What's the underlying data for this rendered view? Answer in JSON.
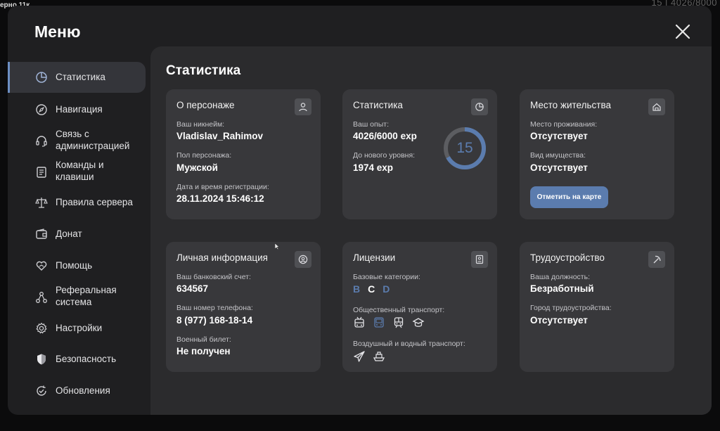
{
  "background": {
    "hud_left": "ерно 11к",
    "hud_right": "15 | 4026/8000"
  },
  "menu": {
    "title": "Меню"
  },
  "sidebar": {
    "items": [
      {
        "label": "Статистика",
        "icon": "pie-chart-icon"
      },
      {
        "label": "Навигация",
        "icon": "compass-icon"
      },
      {
        "label": "Связь с администрацией",
        "icon": "headset-icon"
      },
      {
        "label": "Команды и клавиши",
        "icon": "keyboard-icon"
      },
      {
        "label": "Правила сервера",
        "icon": "scales-icon"
      },
      {
        "label": "Донат",
        "icon": "wallet-icon"
      },
      {
        "label": "Помощь",
        "icon": "heart-hands-icon"
      },
      {
        "label": "Реферальная система",
        "icon": "network-icon"
      },
      {
        "label": "Настройки",
        "icon": "gear-icon"
      },
      {
        "label": "Безопасность",
        "icon": "shield-icon"
      },
      {
        "label": "Обновления",
        "icon": "refresh-check-icon"
      }
    ]
  },
  "main": {
    "title": "Статистика",
    "about": {
      "title": "О персонаже",
      "nickname_label": "Ваш никнейм:",
      "nickname": "Vladislav_Rahimov",
      "gender_label": "Пол персонажа:",
      "gender": "Мужской",
      "reg_label": "Дата и время регистрации:",
      "reg": "28.11.2024 15:46:12"
    },
    "stats": {
      "title": "Статистика",
      "exp_label": "Ваш опыт:",
      "exp": "4026/6000 exp",
      "next_label": "До нового уровня:",
      "next": "1974 exp",
      "level": "15",
      "progress": 0.671
    },
    "residence": {
      "title": "Место жительства",
      "place_label": "Место проживания:",
      "place": "Отсутствует",
      "property_label": "Вид имущества:",
      "property": "Отсутствует",
      "map_button": "Отметить на карте"
    },
    "personal": {
      "title": "Личная информация",
      "bank_label": "Ваш банковский счет:",
      "bank": "634567",
      "phone_label": "Ваш номер телефона:",
      "phone": "8 (977) 168-18-14",
      "military_label": "Военный билет:",
      "military": "Не получен"
    },
    "licenses": {
      "title": "Лицензии",
      "base_label": "Базовые категории:",
      "categories": [
        "B",
        "C",
        "D"
      ],
      "public_label": "Общественный транспорт:",
      "air_label": "Воздушный и водный транспорт:"
    },
    "employment": {
      "title": "Трудоустройство",
      "position_label": "Ваша должность:",
      "position": "Безработный",
      "city_label": "Город трудоустройства:",
      "city": "Отсутствует"
    }
  },
  "colors": {
    "accent": "#5b7cae",
    "card": "#38383b",
    "panel": "#2b2b2d",
    "modal": "#1f1f21"
  }
}
